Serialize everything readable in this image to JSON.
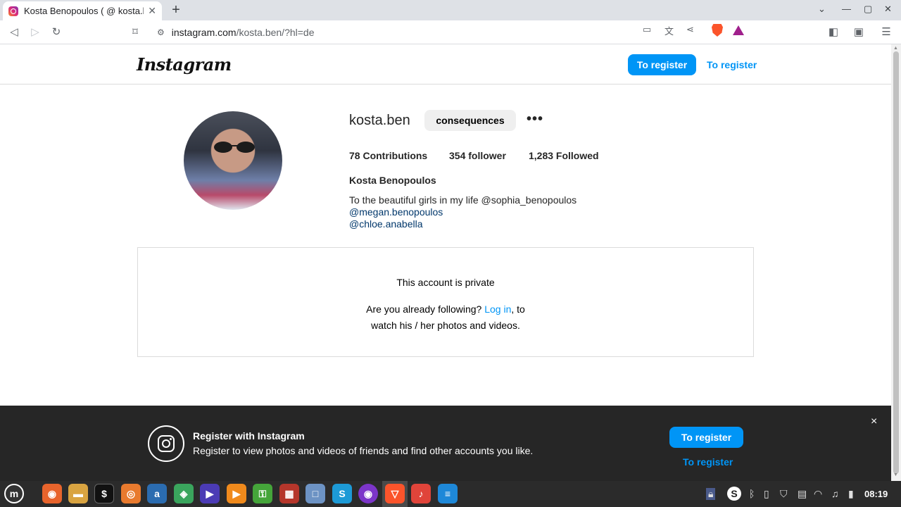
{
  "browser": {
    "tab_title": "Kosta Benopoulos ( @ kosta.b",
    "url_host": "instagram.com",
    "url_path": "/kosta.ben/?hl=de"
  },
  "header": {
    "logo": "Instagram",
    "register_button": "To register",
    "register_link": "To register"
  },
  "profile": {
    "username": "kosta.ben",
    "action_button": "consequences",
    "more": "•••",
    "stats": [
      {
        "label": "78 Contributions"
      },
      {
        "label": "354 follower"
      },
      {
        "label": "1,283 Followed"
      }
    ],
    "full_name": "Kosta Benopoulos",
    "bio_text": "To the beautiful girls in my life @sophia_benopoulos ",
    "bio_mention_1": "@megan.benopoulos",
    "bio_mention_2": "@chloe.anabella"
  },
  "private": {
    "title": "This account is private",
    "line1_before": "Are you already following? ",
    "login_link": "Log in",
    "line1_after": ", to",
    "line2": "watch his / her photos and videos."
  },
  "banner": {
    "title": "Register with Instagram",
    "subtitle": "Register to view photos and videos of friends and find other accounts you like.",
    "register_button": "To register",
    "register_link": "To register",
    "close": "×"
  },
  "taskbar": {
    "clock": "08:19"
  },
  "colors": {
    "accent": "#0095f6",
    "banner_bg": "#262626",
    "mention": "#00376b"
  }
}
